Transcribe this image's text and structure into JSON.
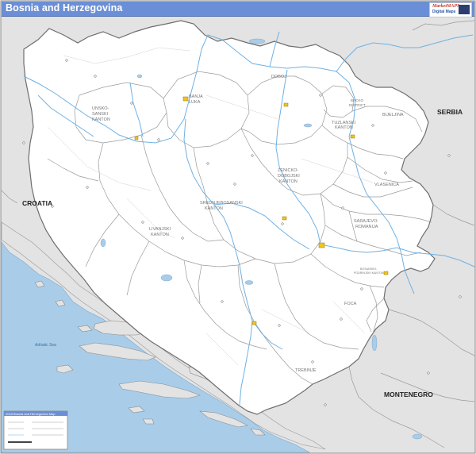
{
  "title": "Bosnia and Herzegovina",
  "logo": {
    "line1": "MarketMAPS",
    "line2": "Digital Maps"
  },
  "countries": {
    "croatia": "CROATIA",
    "serbia": "SERBIA",
    "montenegro": "MONTENEGRO"
  },
  "sea_label": "Adriatic Sea",
  "regions": {
    "unsko_1": "UNSKO-",
    "unsko_2": "SANSKI",
    "unsko_3": "KANTON",
    "banja_1": "BANJA",
    "banja_2": "LUKA",
    "doboj": "DOBOJ",
    "brcko_1": "BRCKO",
    "brcko_2": "DISTRICT",
    "bijeljina": "BIJELJINA",
    "tuzlanski_1": "TUZLANSKI",
    "tuzlanski_2": "KANTON",
    "zenicko_1": "ZENICKO-",
    "zenicko_2": "DOBOJSKI",
    "zenicko_3": "KANTON",
    "vlasenica": "VLASENICA",
    "srednje_1": "SREDNJEBOSANSKI",
    "srednje_2": "KANTON",
    "livanjski_1": "LIVANJSKI",
    "livanjski_2": "KANTON",
    "sarajevo_1": "SARAJEVO-",
    "sarajevo_2": "ROMANIJA",
    "bosansko_1": "BOSANSKO-",
    "bosansko_2": "PODRINJSKI KANTON",
    "foca": "FOCA",
    "trebinje": "TREBINJE"
  },
  "legend": {
    "title": "2018 Bosnia and Herzegovina Map"
  },
  "colors": {
    "water": "#a9cde9",
    "river": "#6fb1e3",
    "neighbor": "#e3e3e3",
    "land": "#ffffff",
    "title_bar": "#6b8fd6",
    "city": "#f0c419"
  }
}
